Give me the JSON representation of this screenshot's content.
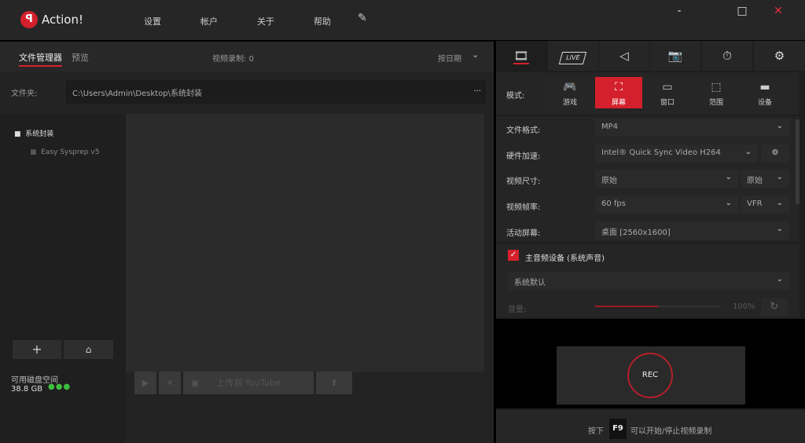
{
  "app": {
    "title": "Action!",
    "logo_text": "Action!"
  },
  "menu": [
    "设置",
    "帐户",
    "关于",
    "帮助"
  ],
  "window": {
    "minimize": "-",
    "maximize": "□",
    "close": "✕"
  },
  "left": {
    "tabs": [
      {
        "label": "文件管理器",
        "active": true
      },
      {
        "label": "预览",
        "active": false
      }
    ],
    "video_count_label": "视频录制: 0",
    "sort_label": "按日期",
    "folder_label": "文件夹:",
    "folder_path": "C:\\Users\\Admin\\Desktop\\系统封装",
    "folder_more": "...",
    "tree": [
      {
        "label": "系统封装"
      },
      {
        "label": "Easy Sysprep v5"
      }
    ],
    "add": "+",
    "disk_label": "可用磁盘空间",
    "disk_value": "38.8 GB",
    "upload_youtube": "上传到 YouTube"
  },
  "right": {
    "tabs": [
      "video",
      "live",
      "audio",
      "screenshot",
      "timer",
      "settings"
    ],
    "live_label": "LIVE",
    "mode_label": "模式:",
    "modes": [
      {
        "label": "游戏",
        "icon": "gamepad"
      },
      {
        "label": "屏幕",
        "icon": "screen",
        "active": true
      },
      {
        "label": "窗口",
        "icon": "window"
      },
      {
        "label": "范围",
        "icon": "region"
      },
      {
        "label": "设备",
        "icon": "hdmi"
      }
    ],
    "settings": [
      {
        "label": "文件格式:",
        "value": "MP4"
      },
      {
        "label": "硬件加速:",
        "value": "Intel® Quick Sync Video H264"
      },
      {
        "label": "视频尺寸:",
        "value": "原始",
        "value2": "原始"
      },
      {
        "label": "视频帧率:",
        "value": "60 fps",
        "value2": "VFR"
      },
      {
        "label": "活动屏幕:",
        "value": "桌面 [2560x1600]"
      }
    ],
    "audio_device_label": "主音频设备 (系统声音)",
    "audio_device_checked": true,
    "audio_source": "系统默认",
    "volume_label": "音量:",
    "volume_value": "100%",
    "volume_percent": 50,
    "rec": "REC",
    "hint_prefix": "按下",
    "hint_key": "F9",
    "hint_suffix": "可以开始/停止视频录制"
  },
  "colors": {
    "accent": "#d4202c",
    "disk_ok": "#3fbf3f"
  }
}
